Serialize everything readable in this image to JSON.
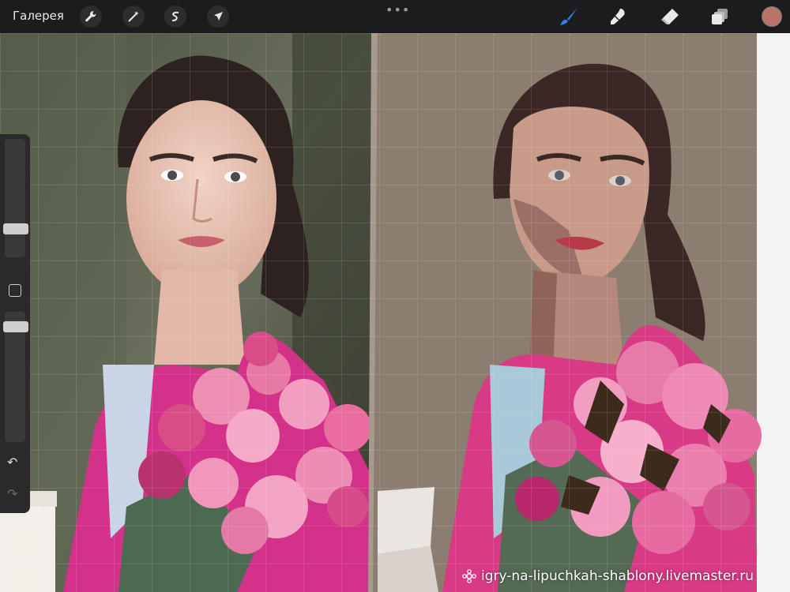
{
  "toolbar": {
    "gallery_label": "Галерея",
    "more_label": "•••",
    "left_tools": [
      "wrench-icon",
      "magic-wand-icon",
      "selection-icon",
      "transform-arrow-icon"
    ],
    "right_tools": [
      "brush-icon",
      "smudge-icon",
      "eraser-icon",
      "layers-icon"
    ],
    "current_color": "#b87466",
    "active_tool_color": "#2f7ff0"
  },
  "sidebar": {
    "undo_label": "↶",
    "redo_label": "↷"
  },
  "watermark": {
    "text": "igry-na-lipuchkah-shablony.livemaster.ru"
  },
  "palette": {
    "painting_background": "#8b7d6f",
    "coat_pink": "#d93a86",
    "skin": "#c79a8a"
  }
}
